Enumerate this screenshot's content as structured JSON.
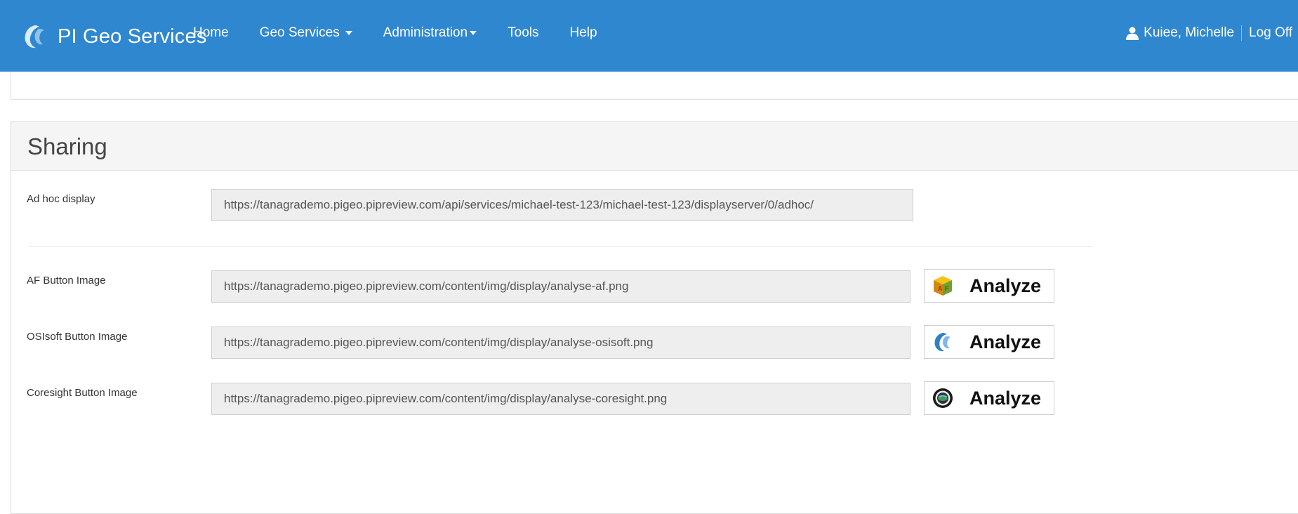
{
  "navbar": {
    "brand": "PI Geo Services",
    "items": [
      {
        "label": "Home",
        "dropdown": false
      },
      {
        "label": "Geo Services",
        "dropdown": true
      },
      {
        "label": "Administration",
        "dropdown": true
      },
      {
        "label": "Tools",
        "dropdown": false
      },
      {
        "label": "Help",
        "dropdown": false
      }
    ],
    "user": "Kuiee, Michelle",
    "logoff": "Log Off",
    "color": "#2f87cf"
  },
  "sharing": {
    "title": "Sharing",
    "adhoc": {
      "label": "Ad hoc display",
      "url": "https://tanagrademo.pigeo.pipreview.com/api/services/michael-test-123/michael-test-123/displayserver/0/adhoc/"
    },
    "buttons": [
      {
        "label": "AF Button Image",
        "url": "https://tanagrademo.pigeo.pipreview.com/content/img/display/analyse-af.png",
        "preview_text": "Analyze",
        "icon": "af-cube-icon"
      },
      {
        "label": "OSIsoft Button Image",
        "url": "https://tanagrademo.pigeo.pipreview.com/content/img/display/analyse-osisoft.png",
        "preview_text": "Analyze",
        "icon": "osisoft-logo-icon"
      },
      {
        "label": "Coresight Button Image",
        "url": "https://tanagrademo.pigeo.pipreview.com/content/img/display/analyse-coresight.png",
        "preview_text": "Analyze",
        "icon": "coresight-logo-icon"
      }
    ]
  }
}
